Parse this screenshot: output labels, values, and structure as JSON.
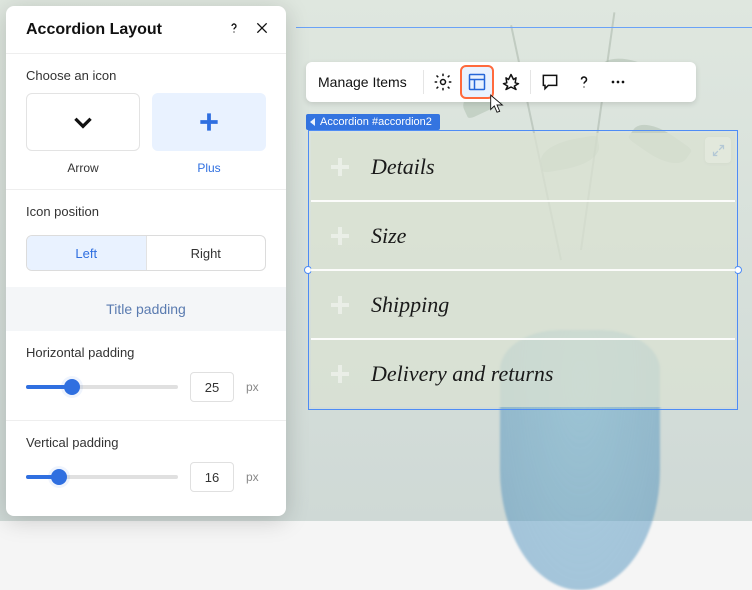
{
  "panel": {
    "title": "Accordion Layout",
    "choose_icon_label": "Choose an icon",
    "icon_arrow_label": "Arrow",
    "icon_plus_label": "Plus",
    "icon_position_label": "Icon position",
    "position_left": "Left",
    "position_right": "Right",
    "title_padding_section": "Title padding",
    "horizontal_padding_label": "Horizontal padding",
    "horizontal_padding_value": "25",
    "vertical_padding_label": "Vertical padding",
    "vertical_padding_value": "16",
    "unit": "px"
  },
  "toolbar": {
    "manage_label": "Manage Items"
  },
  "tag": {
    "label": "Accordion #accordion2"
  },
  "accordion": {
    "items": [
      {
        "title": "Details"
      },
      {
        "title": "Size"
      },
      {
        "title": "Shipping"
      },
      {
        "title": "Delivery and returns"
      }
    ]
  }
}
